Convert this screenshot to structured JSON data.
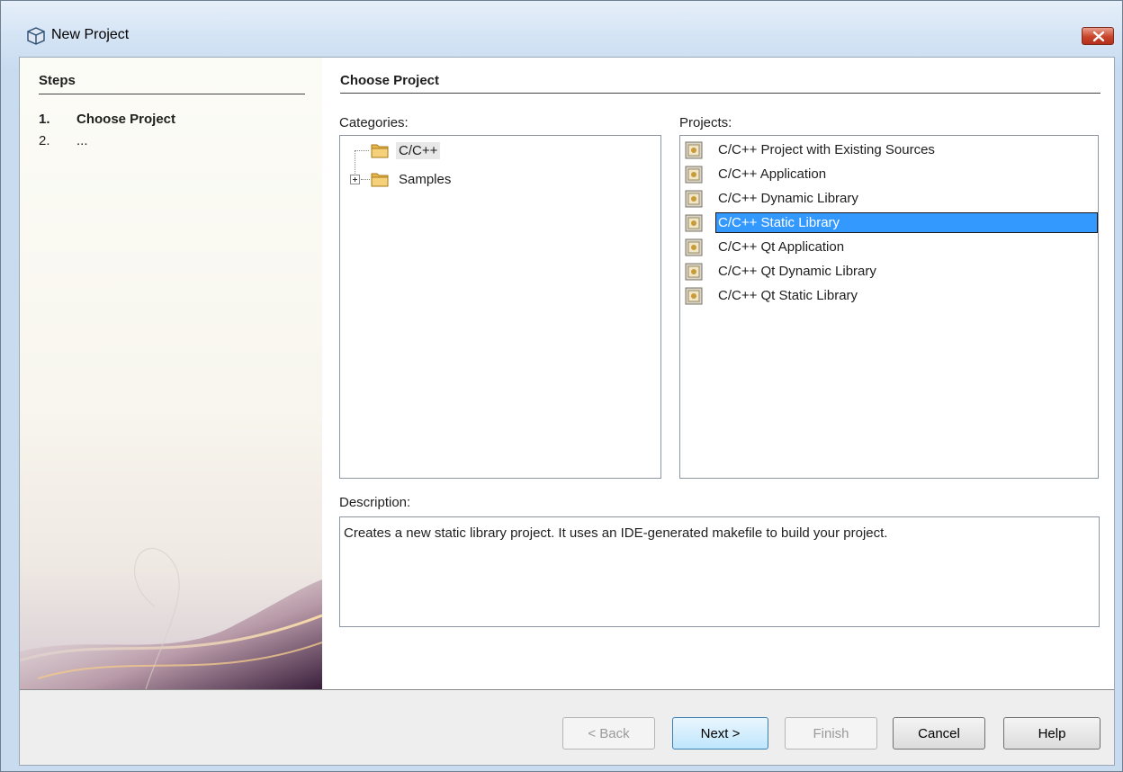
{
  "window": {
    "title": "New Project"
  },
  "steps": {
    "title": "Steps",
    "items": [
      {
        "num": "1.",
        "label": "Choose Project"
      },
      {
        "num": "2.",
        "label": "..."
      }
    ]
  },
  "main": {
    "title": "Choose Project",
    "categories_label": "Categories:",
    "projects_label": "Projects:",
    "description_label": "Description:",
    "categories": [
      {
        "label": "C/C++",
        "selected": true
      },
      {
        "label": "Samples",
        "expandable": true
      }
    ],
    "projects": [
      {
        "label": "C/C++ Project with Existing Sources"
      },
      {
        "label": "C/C++ Application"
      },
      {
        "label": "C/C++ Dynamic Library"
      },
      {
        "label": "C/C++ Static Library",
        "selected": true
      },
      {
        "label": "C/C++ Qt Application"
      },
      {
        "label": "C/C++ Qt Dynamic Library"
      },
      {
        "label": "C/C++ Qt Static Library"
      }
    ],
    "description": "Creates a new static library project. It uses an IDE-generated makefile to build your project."
  },
  "buttons": {
    "back": "< Back",
    "next": "Next >",
    "finish": "Finish",
    "cancel": "Cancel",
    "help": "Help"
  },
  "icons": {
    "window": "cube-icon",
    "close": "close-icon",
    "folder": "folder-icon",
    "expand": "plus-expander-icon",
    "project": "project-template-icon"
  },
  "colors": {
    "selection": "#3399ff",
    "titlebar": "#c8dcf0",
    "close": "#c8442a"
  }
}
